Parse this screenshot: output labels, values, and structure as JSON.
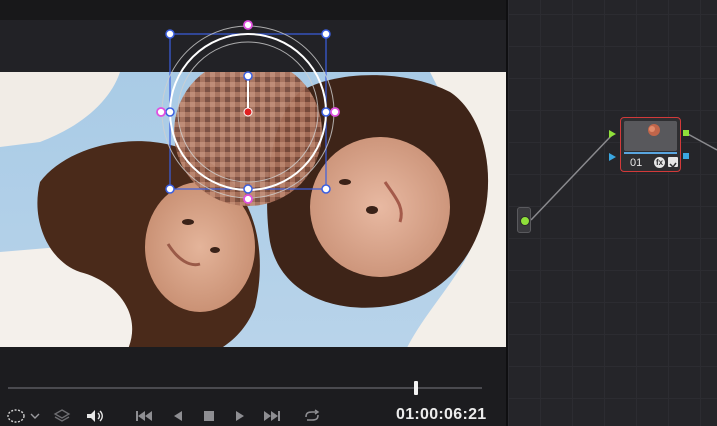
{
  "viewer": {
    "timecode": "01:00:06:21",
    "playhead_fraction": 0.86
  },
  "transport": {
    "icons": [
      "window-shape-icon",
      "chevron-down-icon",
      "layers-icon",
      "speaker-icon",
      "jump-to-start-icon",
      "play-reverse-icon",
      "stop-icon",
      "play-icon",
      "jump-to-end-icon",
      "loop-icon"
    ]
  },
  "node_editor": {
    "node": {
      "label": "01",
      "fx_glyph": "fx"
    },
    "colors": {
      "selected_outline": "#d23a3a",
      "input_port": "#8fe03a",
      "output_port": "#8fe03a",
      "key_port": "#3aa6e0",
      "source_dot": "#8fe03a"
    }
  },
  "window_overlay": {
    "handle_colors": {
      "corner": "#ffffff",
      "softness": "#e050e0",
      "center": "#e02020",
      "frame": "#3b5fe0"
    }
  }
}
